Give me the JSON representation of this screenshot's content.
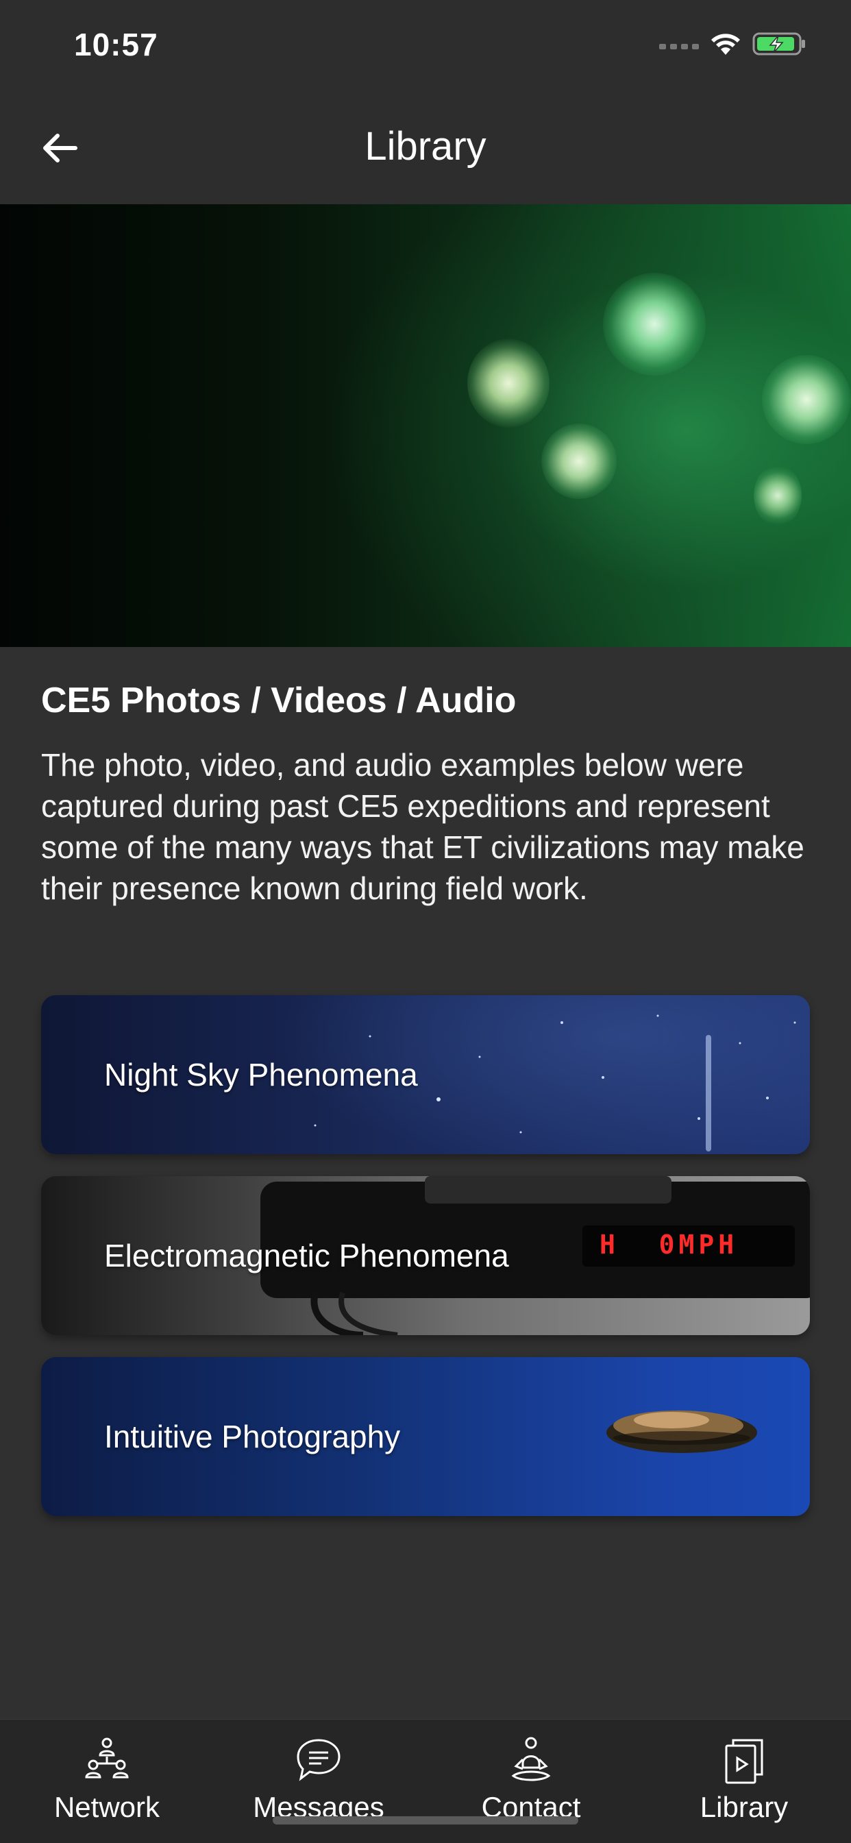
{
  "status": {
    "time": "10:57",
    "signal_icon": "cellular-signal-icon",
    "wifi_icon": "wifi-icon",
    "battery_icon": "battery-charging-icon"
  },
  "header": {
    "title": "Library",
    "back_icon": "arrow-left-icon"
  },
  "content": {
    "title": "CE5 Photos / Videos / Audio",
    "description": "The photo, video, and audio examples below were captured during past CE5 expeditions and represent some of the many ways that ET civilizations may make their presence known during field work."
  },
  "cards": [
    {
      "label": "Night Sky Phenomena"
    },
    {
      "label": "Electromagnetic Phenomena",
      "display_text": "H  0MPH"
    },
    {
      "label": "Intuitive Photography"
    }
  ],
  "tabs": [
    {
      "label": "Network",
      "icon": "network-icon"
    },
    {
      "label": "Messages",
      "icon": "message-bubble-icon"
    },
    {
      "label": "Contact",
      "icon": "meditation-person-icon"
    },
    {
      "label": "Library",
      "icon": "library-icon"
    }
  ],
  "colors": {
    "background": "#303030",
    "bars": "#2d2d2d",
    "tab_bar": "#262626",
    "battery": "#4cd964"
  }
}
